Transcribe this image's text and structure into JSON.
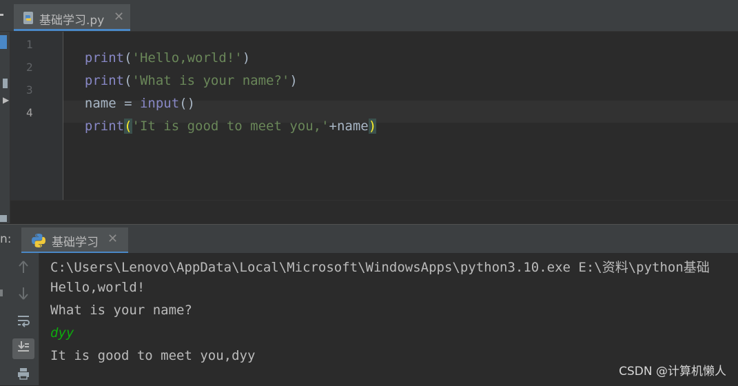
{
  "editor": {
    "tab_label": "基础学习.py",
    "close_glyph": "✕",
    "line_numbers": [
      "1",
      "2",
      "3",
      "4"
    ],
    "lines": [
      [
        {
          "t": "print",
          "c": "kw"
        },
        {
          "t": "(",
          "c": ""
        },
        {
          "t": "'Hello,world!'",
          "c": "str"
        },
        {
          "t": ")",
          "c": ""
        }
      ],
      [
        {
          "t": "print",
          "c": "kw"
        },
        {
          "t": "(",
          "c": ""
        },
        {
          "t": "'What is your name?'",
          "c": "str"
        },
        {
          "t": ")",
          "c": ""
        }
      ],
      [
        {
          "t": "name = ",
          "c": ""
        },
        {
          "t": "input",
          "c": "kw"
        },
        {
          "t": "()",
          "c": ""
        }
      ],
      [
        {
          "t": "print",
          "c": "kw"
        },
        {
          "t": "(",
          "c": "paren-hl"
        },
        {
          "t": "'It is good to meet you,'",
          "c": "str"
        },
        {
          "t": "+name",
          "c": ""
        },
        {
          "t": ")",
          "c": "paren-hl"
        }
      ]
    ]
  },
  "run_panel": {
    "label": "n:",
    "tab_label": "基础学习",
    "close_glyph": "✕",
    "toolbar_icons": [
      "up-arrow-icon",
      "down-arrow-icon",
      "soft-wrap-icon",
      "scroll-to-end-icon",
      "print-icon"
    ],
    "console": [
      {
        "text": "C:\\Users\\Lenovo\\AppData\\Local\\Microsoft\\WindowsApps\\python3.10.exe E:\\资料\\python基础",
        "type": "output"
      },
      {
        "text": "Hello,world!",
        "type": "output"
      },
      {
        "text": "What is your name?",
        "type": "output"
      },
      {
        "text": "dyy",
        "type": "input"
      },
      {
        "text": "It is good to meet you,dyy",
        "type": "output"
      }
    ]
  },
  "watermark": "CSDN @计算机懒人",
  "colors": {
    "background": "#2b2b2b",
    "keyword": "#8888c6",
    "string": "#6a8759",
    "user_input": "#0eaa0e",
    "accent": "#4a88c7"
  }
}
